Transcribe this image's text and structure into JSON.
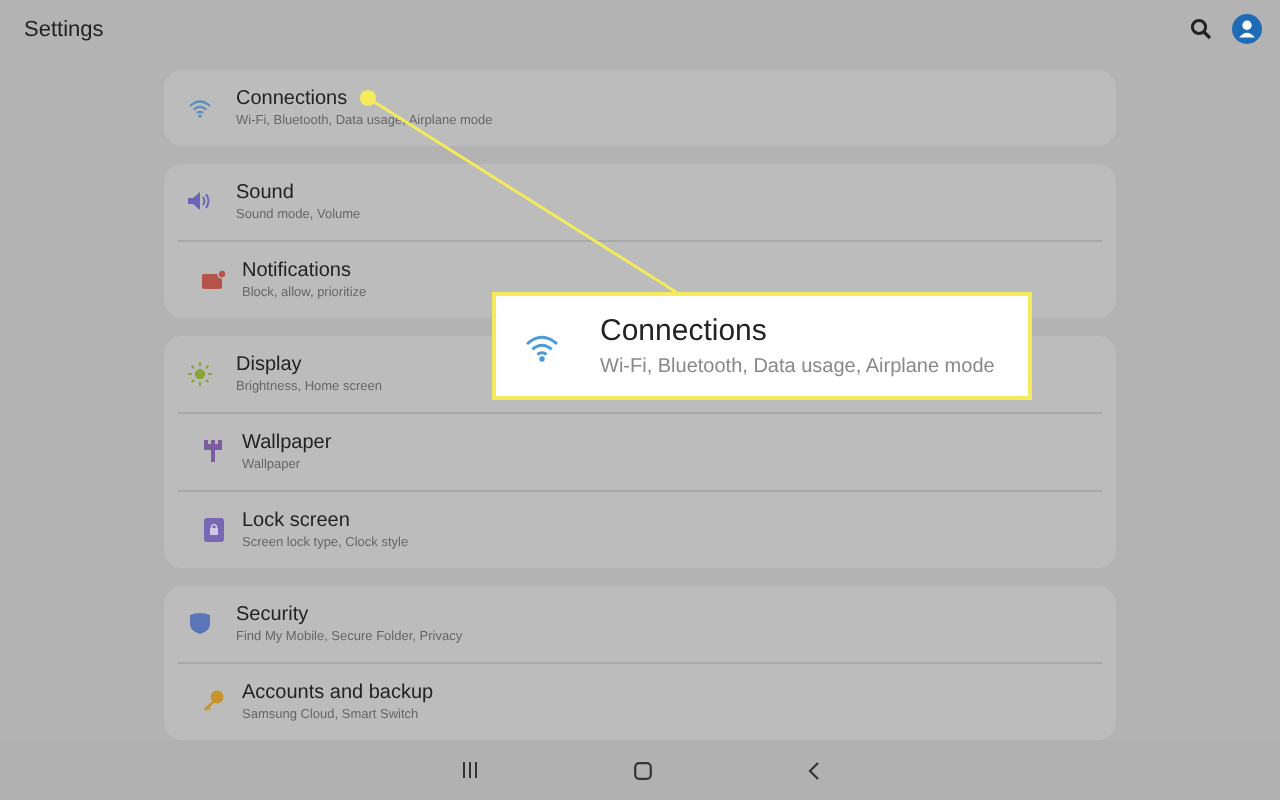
{
  "header": {
    "title": "Settings"
  },
  "groups": [
    {
      "items": [
        {
          "kind": "wifi",
          "title": "Connections",
          "subtitle": "Wi-Fi, Bluetooth, Data usage, Airplane mode"
        }
      ]
    },
    {
      "items": [
        {
          "kind": "sound",
          "title": "Sound",
          "subtitle": "Sound mode, Volume"
        },
        {
          "kind": "notifications",
          "title": "Notifications",
          "subtitle": "Block, allow, prioritize"
        }
      ]
    },
    {
      "items": [
        {
          "kind": "display",
          "title": "Display",
          "subtitle": "Brightness, Home screen"
        },
        {
          "kind": "wallpaper",
          "title": "Wallpaper",
          "subtitle": "Wallpaper"
        },
        {
          "kind": "lock",
          "title": "Lock screen",
          "subtitle": "Screen lock type, Clock style"
        }
      ]
    },
    {
      "items": [
        {
          "kind": "security",
          "title": "Security",
          "subtitle": "Find My Mobile, Secure Folder, Privacy"
        },
        {
          "kind": "key",
          "title": "Accounts and backup",
          "subtitle": "Samsung Cloud, Smart Switch"
        }
      ]
    }
  ],
  "callout": {
    "kind": "wifi",
    "title": "Connections",
    "subtitle": "Wi-Fi, Bluetooth, Data usage, Airplane mode"
  }
}
